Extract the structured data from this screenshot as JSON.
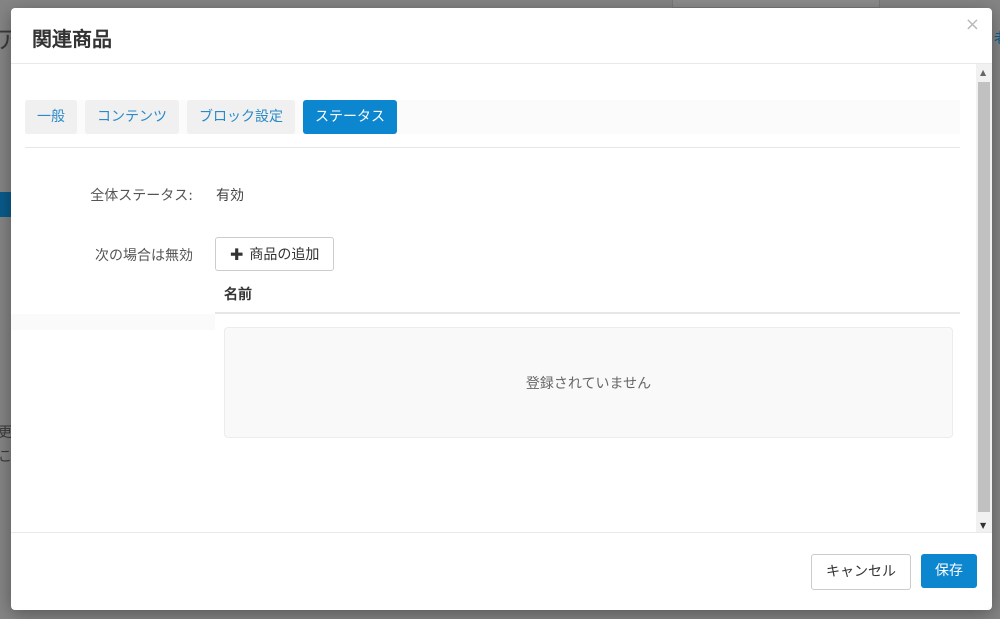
{
  "background": {
    "left_glyph": "ア",
    "right_glyph": "老",
    "left_text_1": "更",
    "left_text_2": "こ"
  },
  "modal": {
    "title": "関連商品",
    "close_symbol": "×"
  },
  "tabs": [
    {
      "label": "一般",
      "active": false
    },
    {
      "label": "コンテンツ",
      "active": false
    },
    {
      "label": "ブロック設定",
      "active": false
    },
    {
      "label": "ステータス",
      "active": true
    }
  ],
  "status": {
    "overall_label": "全体ステータス:",
    "overall_value": "有効",
    "disabled_label": "次の場合は無効",
    "add_button_label": "商品の追加",
    "column_header": "名前",
    "empty_message": "登録されていません"
  },
  "footer": {
    "cancel_label": "キャンセル",
    "save_label": "保存"
  },
  "colors": {
    "primary": "#0b86cf",
    "tab_text": "#2a8ac7"
  }
}
